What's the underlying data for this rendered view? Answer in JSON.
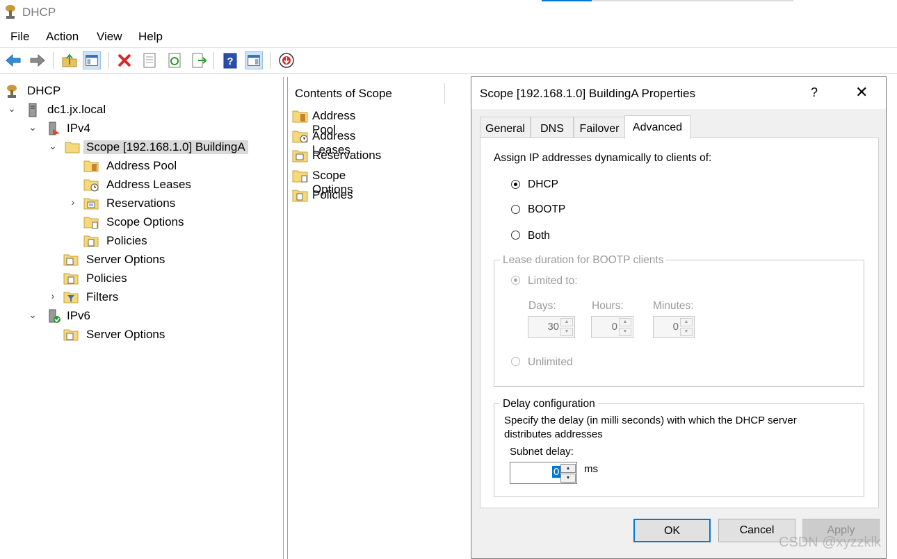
{
  "window": {
    "title": "DHCP"
  },
  "menu": [
    "File",
    "Action",
    "View",
    "Help"
  ],
  "toolbar": {
    "buttons": [
      "back-arrow-icon",
      "forward-arrow-icon",
      "up-folder-icon",
      "show-hide-console-tree-icon",
      "delete-icon",
      "properties-icon",
      "refresh-icon",
      "export-list-icon",
      "help-icon",
      "show-hide-action-pane-icon",
      "stop-icon"
    ]
  },
  "tree": {
    "root": "DHCP",
    "server": "dc1.jx.local",
    "ipv4": "IPv4",
    "scope": "Scope [192.168.1.0] BuildingA",
    "scope_children": [
      "Address Pool",
      "Address Leases",
      "Reservations",
      "Scope Options",
      "Policies"
    ],
    "ipv4_children": [
      "Server Options",
      "Policies",
      "Filters"
    ],
    "ipv6": "IPv6",
    "ipv6_children": [
      "Server Options"
    ]
  },
  "contents": {
    "header": "Contents of Scope",
    "items": [
      "Address Pool",
      "Address Leases",
      "Reservations",
      "Scope Options",
      "Policies"
    ]
  },
  "dialog": {
    "title": "Scope [192.168.1.0] BuildingA Properties",
    "help_glyph": "?",
    "close_glyph": "✕",
    "tabs": [
      "General",
      "DNS",
      "Failover",
      "Advanced"
    ],
    "active_tab": "Advanced",
    "assign_label": "Assign IP addresses dynamically to clients of:",
    "assign_options": [
      "DHCP",
      "BOOTP",
      "Both"
    ],
    "assign_selected": "DHCP",
    "lease_group": {
      "legend": "Lease duration for BOOTP clients",
      "limited_label": "Limited to:",
      "days_label": "Days:",
      "hours_label": "Hours:",
      "minutes_label": "Minutes:",
      "days": "30",
      "hours": "0",
      "minutes": "0",
      "unlimited_label": "Unlimited"
    },
    "delay_group": {
      "legend": "Delay configuration",
      "description_line1": "Specify the delay (in milli seconds) with which the DHCP server",
      "description_line2": "distributes addresses",
      "subnet_delay_label": "Subnet delay:",
      "subnet_delay_value": "0",
      "unit": "ms"
    },
    "buttons": {
      "ok": "OK",
      "cancel": "Cancel",
      "apply": "Apply"
    }
  },
  "watermark": "CSDN @xyzzklk",
  "colors": {
    "accent": "#0078d7",
    "selection": "#d9d9d9",
    "dialog_bg": "#f0f0f0"
  }
}
